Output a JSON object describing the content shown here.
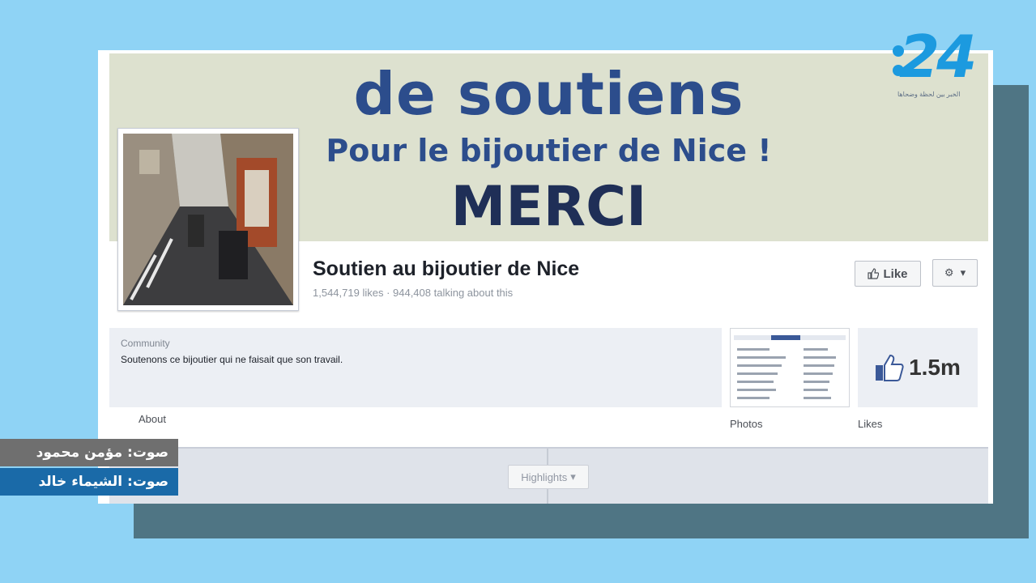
{
  "cover": {
    "line1": "de soutiens",
    "line2": "Pour le bijoutier de Nice !",
    "line3": "MERCI"
  },
  "page": {
    "name": "Soutien au bijoutier de Nice",
    "stats": "1,544,719 likes · 944,408 talking about this",
    "like_button": "Like"
  },
  "about": {
    "category": "Community",
    "description": "Soutenons ce bijoutier qui ne faisait que son travail.",
    "tab_label": "About"
  },
  "photos": {
    "tab_label": "Photos"
  },
  "likes": {
    "count": "1.5m",
    "tab_label": "Likes"
  },
  "timeline": {
    "highlights_label": "Highlights"
  },
  "logo": {
    "number": "24",
    "tagline": "الخبر بين لحظة وضحاها"
  },
  "credits": [
    {
      "text": "صوت: مؤمن محمود"
    },
    {
      "text": "صوت: الشيماء خالد"
    }
  ],
  "colors": {
    "background": "#8fd3f5",
    "cover_text": "#2c4d8c",
    "logo": "#1c9adf",
    "credit_top": "#6f6f6f",
    "credit_bottom": "#1a6aa8"
  }
}
